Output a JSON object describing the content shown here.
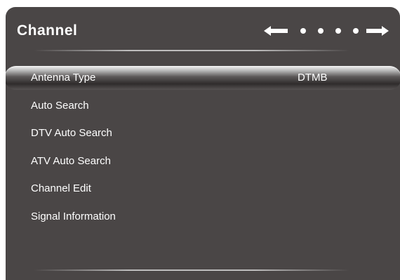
{
  "menu": {
    "title": "Channel",
    "items": [
      {
        "label": "Antenna Type",
        "value": "DTMB"
      },
      {
        "label": "Auto Search"
      },
      {
        "label": "DTV Auto Search"
      },
      {
        "label": "ATV Auto Search"
      },
      {
        "label": "Channel Edit"
      },
      {
        "label": "Signal Information"
      }
    ]
  },
  "icons": {
    "nav_left": "arrow-left-icon",
    "nav_right": "arrow-right-icon",
    "page_dots": "dot-icon"
  },
  "colors": {
    "panel_background": "#4a4646",
    "text": "#ffffff"
  }
}
